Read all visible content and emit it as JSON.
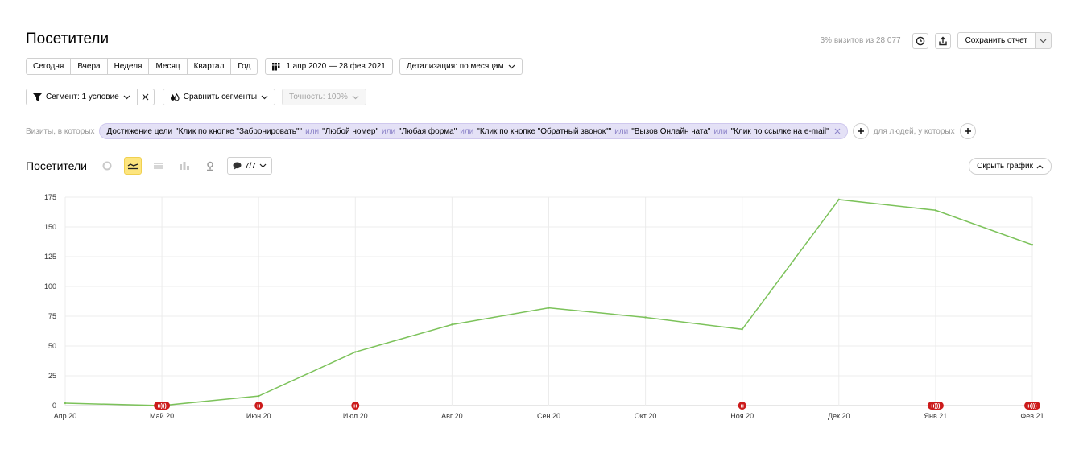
{
  "header": {
    "title": "Посетители",
    "sampling_text": "3% визитов из 28 077",
    "save_label": "Сохранить отчет"
  },
  "periods": [
    "Сегодня",
    "Вчера",
    "Неделя",
    "Месяц",
    "Квартал",
    "Год"
  ],
  "date_range": "1 апр 2020 — 28 фев 2021",
  "detail": "Детализация: по месяцам",
  "segment": {
    "label": "Сегмент: 1 условие",
    "compare": "Сравнить сегменты",
    "accuracy": "Точность: 100%"
  },
  "filter": {
    "prefix": "Визиты, в которых",
    "goal_prefix": "Достижение цели",
    "connector": "или",
    "conditions": [
      "\"Клик по кнопке \"Забронировать\"\"",
      "\"Любой номер\"",
      "\"Любая форма\"",
      "\"Клик по кнопке \"Обратный звонок\"\"",
      "\"Вызов Онлайн чата\"",
      "\"Клик по ссылке на e-mail\""
    ],
    "people_label": "для людей, у которых"
  },
  "chart_section": {
    "title": "Посетители",
    "notes_label": "7/7",
    "hide_label": "Скрыть график"
  },
  "colors": {
    "line": "#7cc25a",
    "marker": "#cc1b1b",
    "filter_bg": "#e4e1f6",
    "active_mode": "#fde57e"
  },
  "chart_data": {
    "type": "line",
    "categories": [
      "Апр 20",
      "Май 20",
      "Июн 20",
      "Июл 20",
      "Авг 20",
      "Сен 20",
      "Окт 20",
      "Ноя 20",
      "Дек 20",
      "Янв 21",
      "Фев 21"
    ],
    "series": [
      {
        "values": [
          2,
          0,
          8,
          45,
          68,
          82,
          74,
          64,
          173,
          164,
          135
        ]
      }
    ],
    "y_ticks": [
      0,
      25,
      50,
      75,
      100,
      125,
      150,
      175
    ],
    "ylim": [
      0,
      175
    ],
    "grid": true,
    "annotations": [
      {
        "category_index": 1,
        "label": "н)))"
      },
      {
        "category_index": 2,
        "label": "н"
      },
      {
        "category_index": 3,
        "label": "н"
      },
      {
        "category_index": 7,
        "label": "н"
      },
      {
        "category_index": 9,
        "label": "н)))"
      },
      {
        "category_index": 10,
        "label": "н)))"
      }
    ]
  }
}
